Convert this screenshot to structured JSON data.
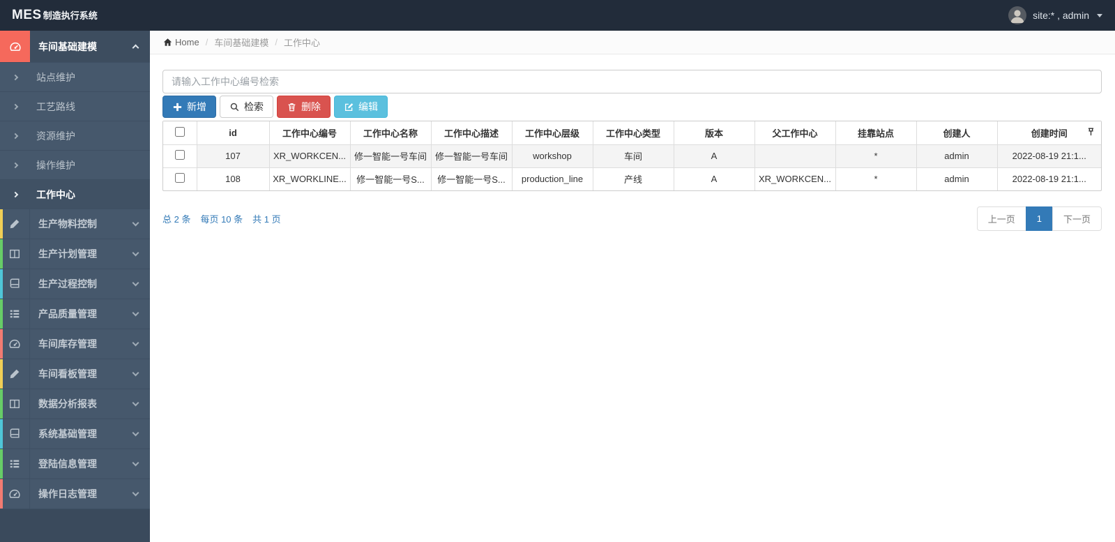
{
  "navbar": {
    "brand_bold": "MES",
    "brand_rest": "制造执行系统",
    "user_label": "site:* , admin"
  },
  "breadcrumb": {
    "home": "Home",
    "separator": "/",
    "items": [
      "车间基础建模",
      "工作中心"
    ]
  },
  "sidebar": {
    "active_group": {
      "label": "车间基础建模",
      "icon": "gauge-icon",
      "accent": "#f5695c"
    },
    "submenu": [
      "站点维护",
      "工艺路线",
      "资源维护",
      "操作维护",
      "工作中心"
    ],
    "active_submenu": "工作中心",
    "groups": [
      {
        "label": "生产物料控制",
        "icon": "pencil-icon",
        "stripe": "#f0cf56"
      },
      {
        "label": "生产计划管理",
        "icon": "columns-icon",
        "stripe": "#67cd67"
      },
      {
        "label": "生产过程控制",
        "icon": "book-icon",
        "stripe": "#4fc6d8"
      },
      {
        "label": "产品质量管理",
        "icon": "list-icon",
        "stripe": "#67cd67"
      },
      {
        "label": "车间库存管理",
        "icon": "gauge-icon",
        "stripe": "#f27b72"
      },
      {
        "label": "车间看板管理",
        "icon": "pencil-icon",
        "stripe": "#f0cf56"
      },
      {
        "label": "数据分析报表",
        "icon": "columns-icon",
        "stripe": "#67cd67"
      },
      {
        "label": "系统基础管理",
        "icon": "book-icon",
        "stripe": "#4fc6d8"
      },
      {
        "label": "登陆信息管理",
        "icon": "list-icon",
        "stripe": "#67cd67"
      },
      {
        "label": "操作日志管理",
        "icon": "gauge-icon",
        "stripe": "#f27b72"
      }
    ]
  },
  "search": {
    "placeholder": "请输入工作中心编号检索"
  },
  "toolbar": {
    "add": "新增",
    "search": "检索",
    "delete": "删除",
    "edit": "编辑"
  },
  "table": {
    "columns": [
      "id",
      "工作中心编号",
      "工作中心名称",
      "工作中心描述",
      "工作中心层级",
      "工作中心类型",
      "版本",
      "父工作中心",
      "挂靠站点",
      "创建人",
      "创建时间"
    ],
    "rows": [
      [
        "107",
        "XR_WORKCEN...",
        "修一智能一号车间",
        "修一智能一号车间",
        "workshop",
        "车间",
        "A",
        "",
        "*",
        "admin",
        "2022-08-19 21:1..."
      ],
      [
        "108",
        "XR_WORKLINE...",
        "修一智能一号S...",
        "修一智能一号S...",
        "production_line",
        "产线",
        "A",
        "XR_WORKCEN...",
        "*",
        "admin",
        "2022-08-19 21:1..."
      ]
    ]
  },
  "pagination": {
    "summary_total": "总 2 条",
    "summary_per_page": "每页 10 条",
    "summary_pages": "共 1 页",
    "prev": "上一页",
    "current": "1",
    "next": "下一页"
  },
  "colors": {
    "navbar_bg": "#222c3a",
    "sidebar_row_bg": "#46586c",
    "sidebar_active_accent": "#f5695c",
    "primary": "#337ab7",
    "danger": "#d9534f",
    "info": "#5bc0de",
    "striped_row": "#f4f4f4"
  }
}
